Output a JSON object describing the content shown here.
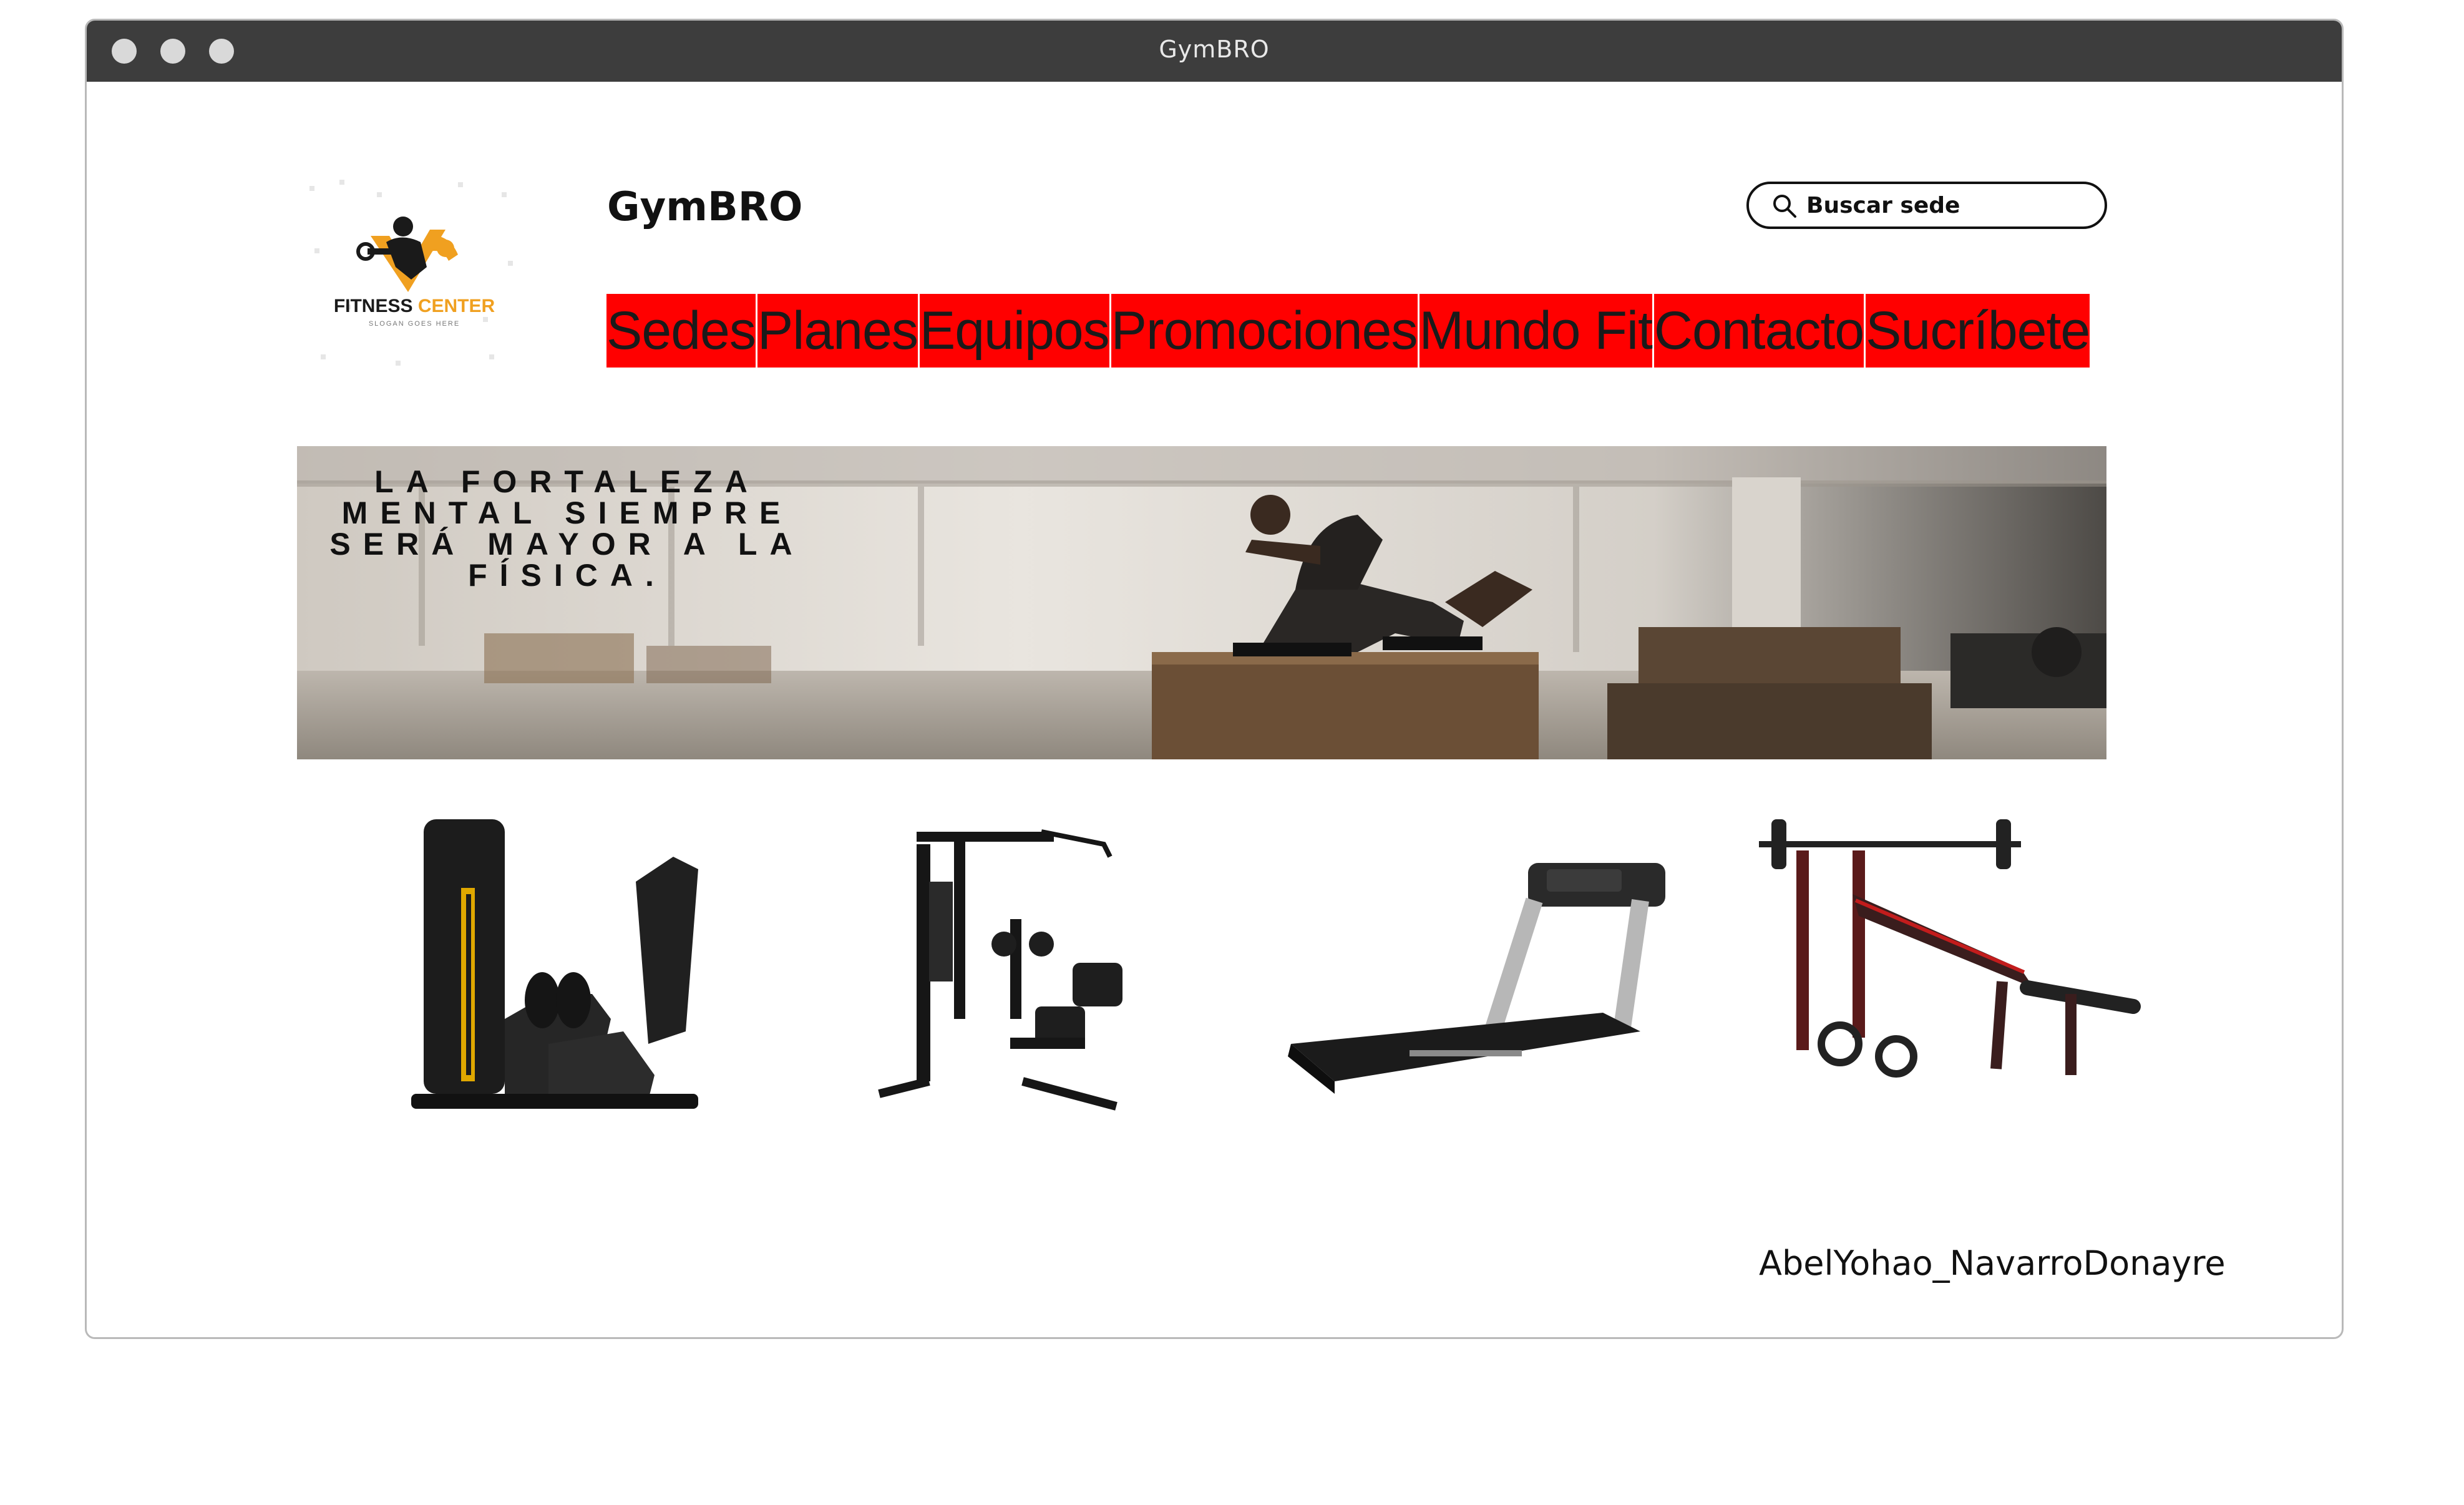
{
  "window": {
    "title": "GymBRO"
  },
  "header": {
    "site_title": "GymBRO",
    "logo_text": "FITNESS CENTER",
    "logo_sub": "SLOGAN GOES HERE",
    "search_placeholder": "Buscar sede"
  },
  "nav": {
    "items": [
      {
        "label": "Sedes"
      },
      {
        "label": "Planes"
      },
      {
        "label": "Equipos"
      },
      {
        "label": "Promociones"
      },
      {
        "label": "Mundo Fit"
      },
      {
        "label": "Contacto"
      },
      {
        "label": "Sucríbete"
      }
    ]
  },
  "banner": {
    "quote": "LA FORTALEZA\nMENTAL SIEMPRE\nSERÁ MAYOR A LA\nFÍSICA."
  },
  "equipment": [
    {
      "name": "abductor-machine"
    },
    {
      "name": "home-gym-station"
    },
    {
      "name": "treadmill"
    },
    {
      "name": "weight-bench"
    }
  ],
  "footer": {
    "author": "AbelYohao_NavarroDonayre"
  },
  "colors": {
    "nav_bg": "#ff0000",
    "titlebar": "#3d3d3d",
    "accent_orange": "#f0a020"
  }
}
